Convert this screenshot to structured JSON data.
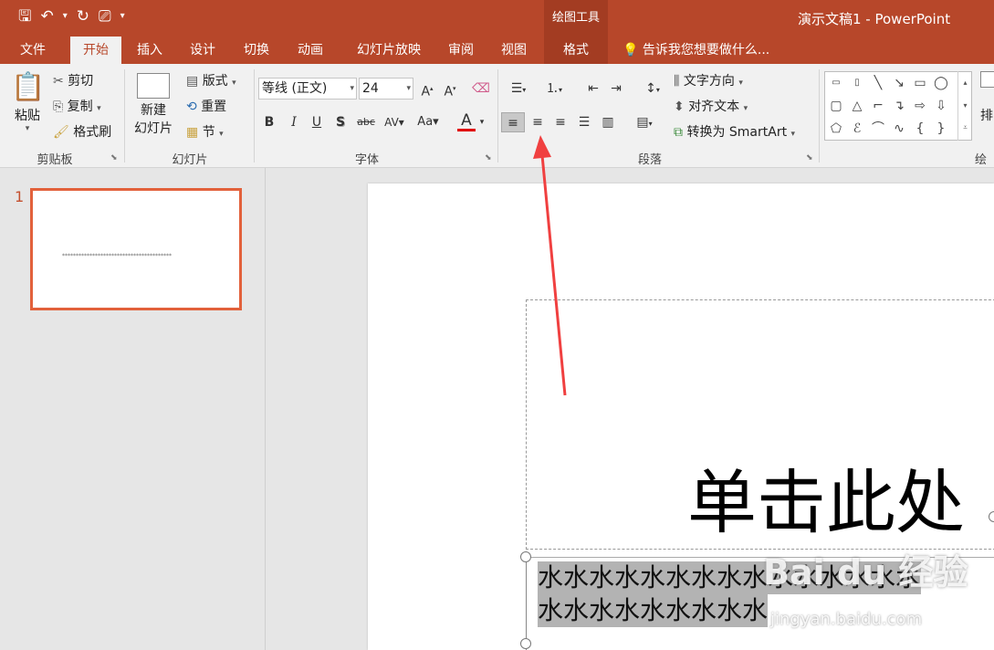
{
  "titlebar": {
    "document_title": "演示文稿1 - PowerPoint",
    "contextual_group": "绘图工具"
  },
  "tabs": {
    "file": "文件",
    "home": "开始",
    "insert": "插入",
    "design": "设计",
    "transitions": "切换",
    "animations": "动画",
    "slideshow": "幻灯片放映",
    "review": "审阅",
    "view": "视图",
    "format": "格式",
    "tell_me": "告诉我您想要做什么..."
  },
  "clipboard": {
    "paste": "粘贴",
    "cut": "剪切",
    "copy": "复制",
    "format_painter": "格式刷",
    "group_label": "剪贴板"
  },
  "slides_group": {
    "new_slide_line1": "新建",
    "new_slide_line2": "幻灯片",
    "layout": "版式",
    "reset": "重置",
    "section": "节",
    "group_label": "幻灯片"
  },
  "font_group": {
    "font_name": "等线 (正文)",
    "font_size": "24",
    "group_label": "字体"
  },
  "paragraph_group": {
    "text_direction": "文字方向",
    "align_text": "对齐文本",
    "convert_smartart": "转换为 SmartArt",
    "group_label": "段落"
  },
  "drawing_group": {
    "arrange": "排",
    "group_label": "绘图"
  },
  "thumbnail": {
    "number": "1",
    "text": "****************************************"
  },
  "slide": {
    "title_text": "单击此处",
    "subtitle_line1": "水水水水水水水水水水水水水水水",
    "subtitle_line2": "水水水水水水水水水"
  },
  "watermark": {
    "text": "Bai du 经验",
    "url": "jingyan.baidu.com"
  },
  "colors": {
    "accent": "#b7472a",
    "arrow": "#f04040"
  }
}
